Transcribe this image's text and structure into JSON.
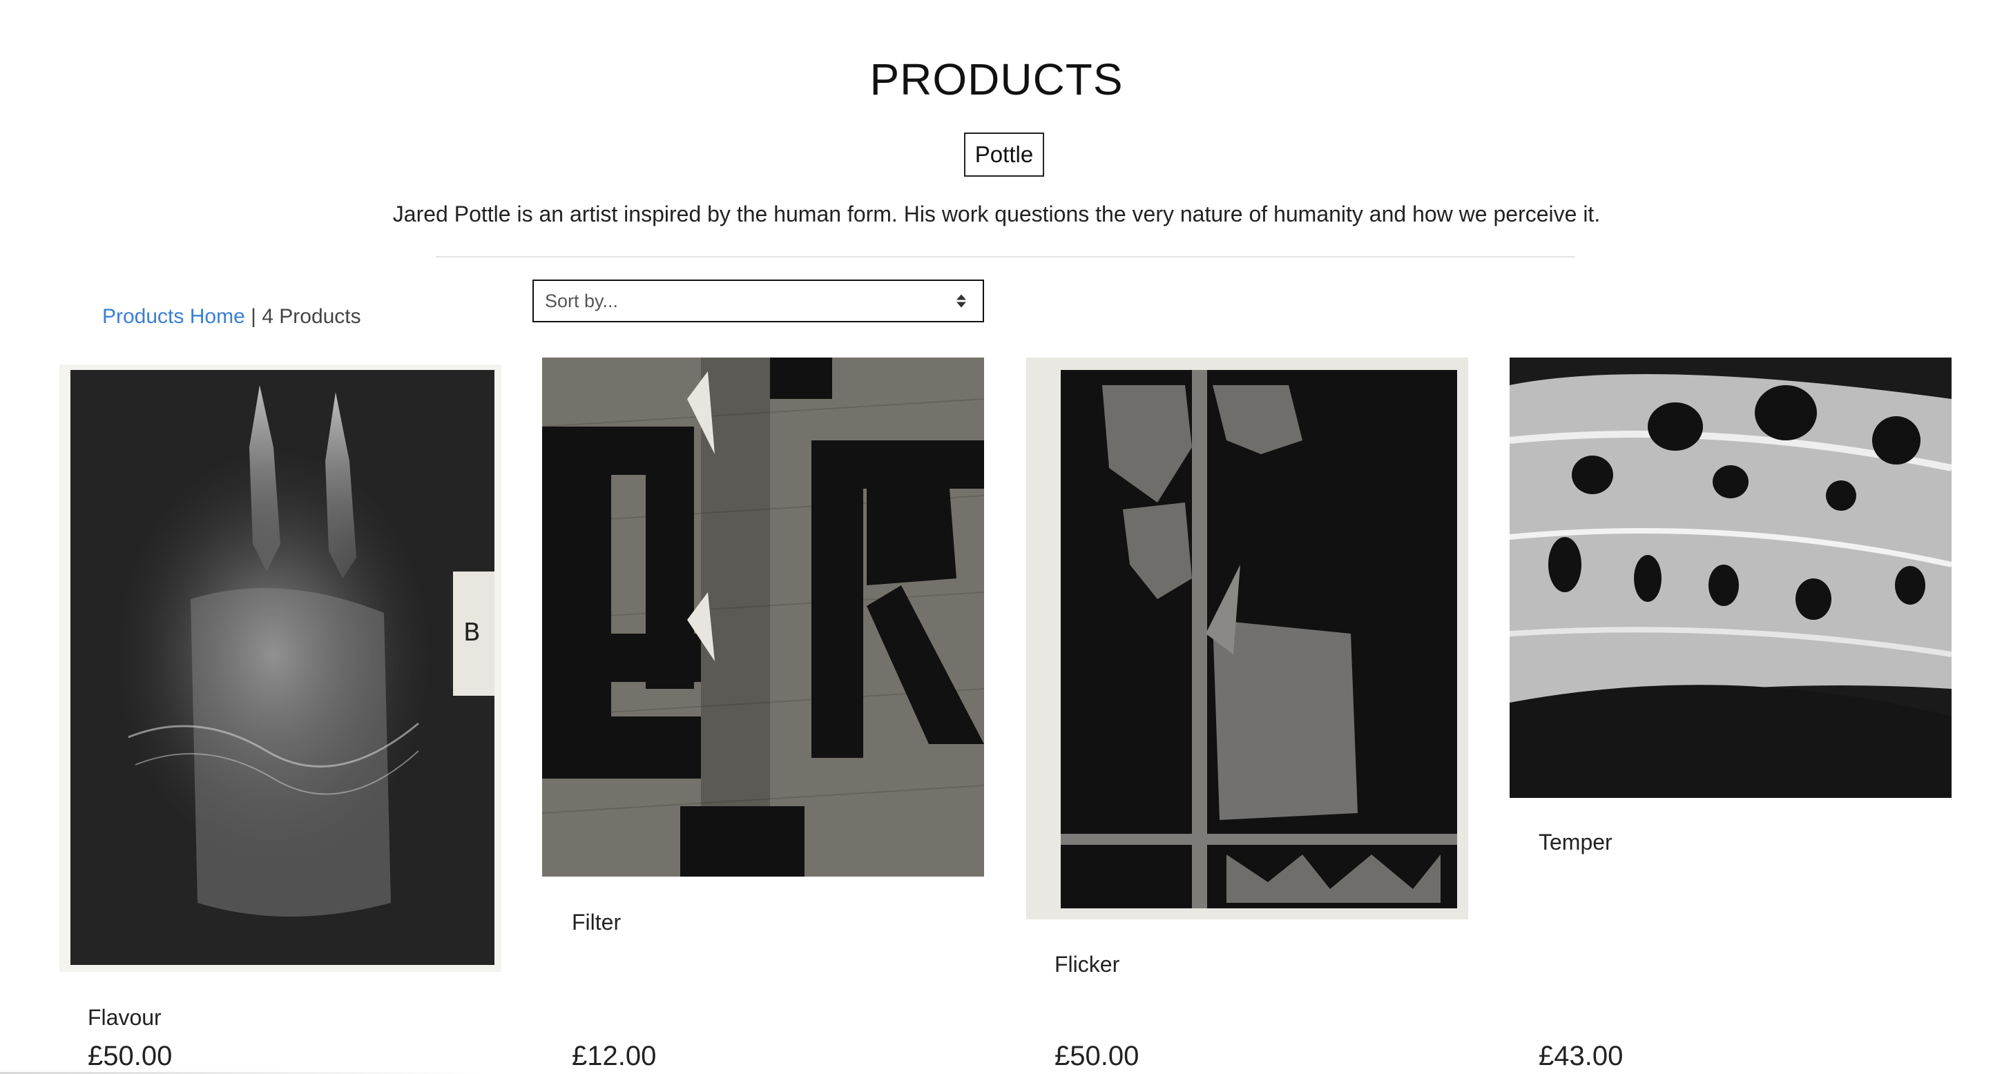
{
  "header": {
    "title": "PRODUCTS",
    "category_tag": "Pottle",
    "description": "Jared Pottle is an artist inspired by the human form. His work questions the very nature of humanity and how we perceive it."
  },
  "toolbar": {
    "breadcrumb_link": "Products Home",
    "separator": "|",
    "product_count": "4 Products",
    "sort_placeholder": "Sort by..."
  },
  "products": [
    {
      "name": "Flavour",
      "price": "£50.00"
    },
    {
      "name": "Filter",
      "price": "£12.00"
    },
    {
      "name": "Flicker",
      "price": "£50.00"
    },
    {
      "name": "Temper",
      "price": "£43.00"
    }
  ]
}
